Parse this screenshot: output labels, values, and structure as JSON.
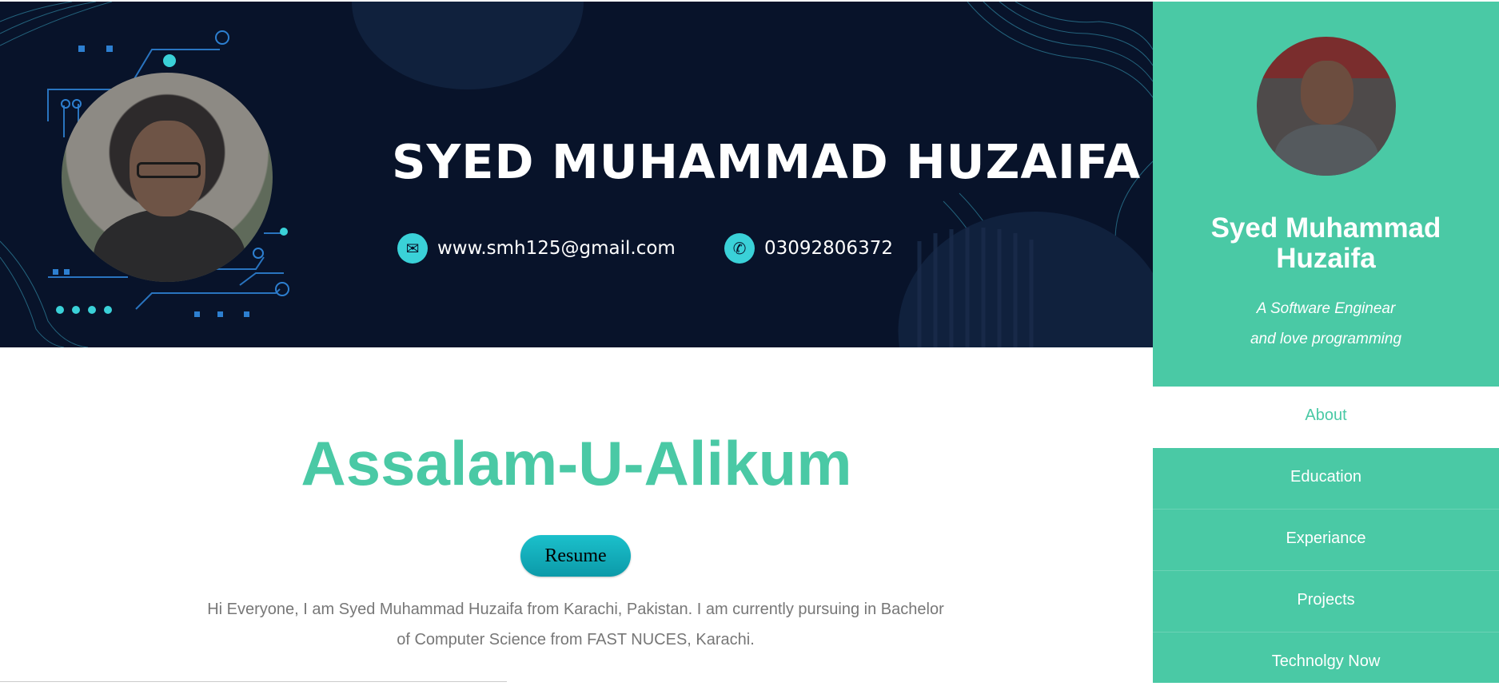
{
  "banner": {
    "name": "SYED MUHAMMAD HUZAIFA",
    "email": "www.smh125@gmail.com",
    "phone": "03092806372"
  },
  "main": {
    "greeting": "Assalam-U-Alikum",
    "resume_label": "Resume",
    "intro_line1": "Hi Everyone, I am Syed Muhammad Huzaifa from Karachi, Pakistan. I am currently pursuing in Bachelor",
    "intro_line2": "of Computer Science from FAST NUCES, Karachi."
  },
  "sidebar": {
    "name_line1": "Syed Muhammad",
    "name_line2": "Huzaifa",
    "tagline_line1": "A Software Enginear",
    "tagline_line2": "and love programming",
    "nav": [
      {
        "label": "About",
        "active": true
      },
      {
        "label": "Education",
        "active": false
      },
      {
        "label": "Experiance",
        "active": false
      },
      {
        "label": "Projects",
        "active": false
      },
      {
        "label": "Technolgy Now",
        "active": false
      }
    ]
  },
  "colors": {
    "accent": "#4ac9a5",
    "banner_bg": "#08132a",
    "button": "#13aebb"
  },
  "icons": {
    "email": "mail-icon",
    "phone": "phone-icon"
  }
}
